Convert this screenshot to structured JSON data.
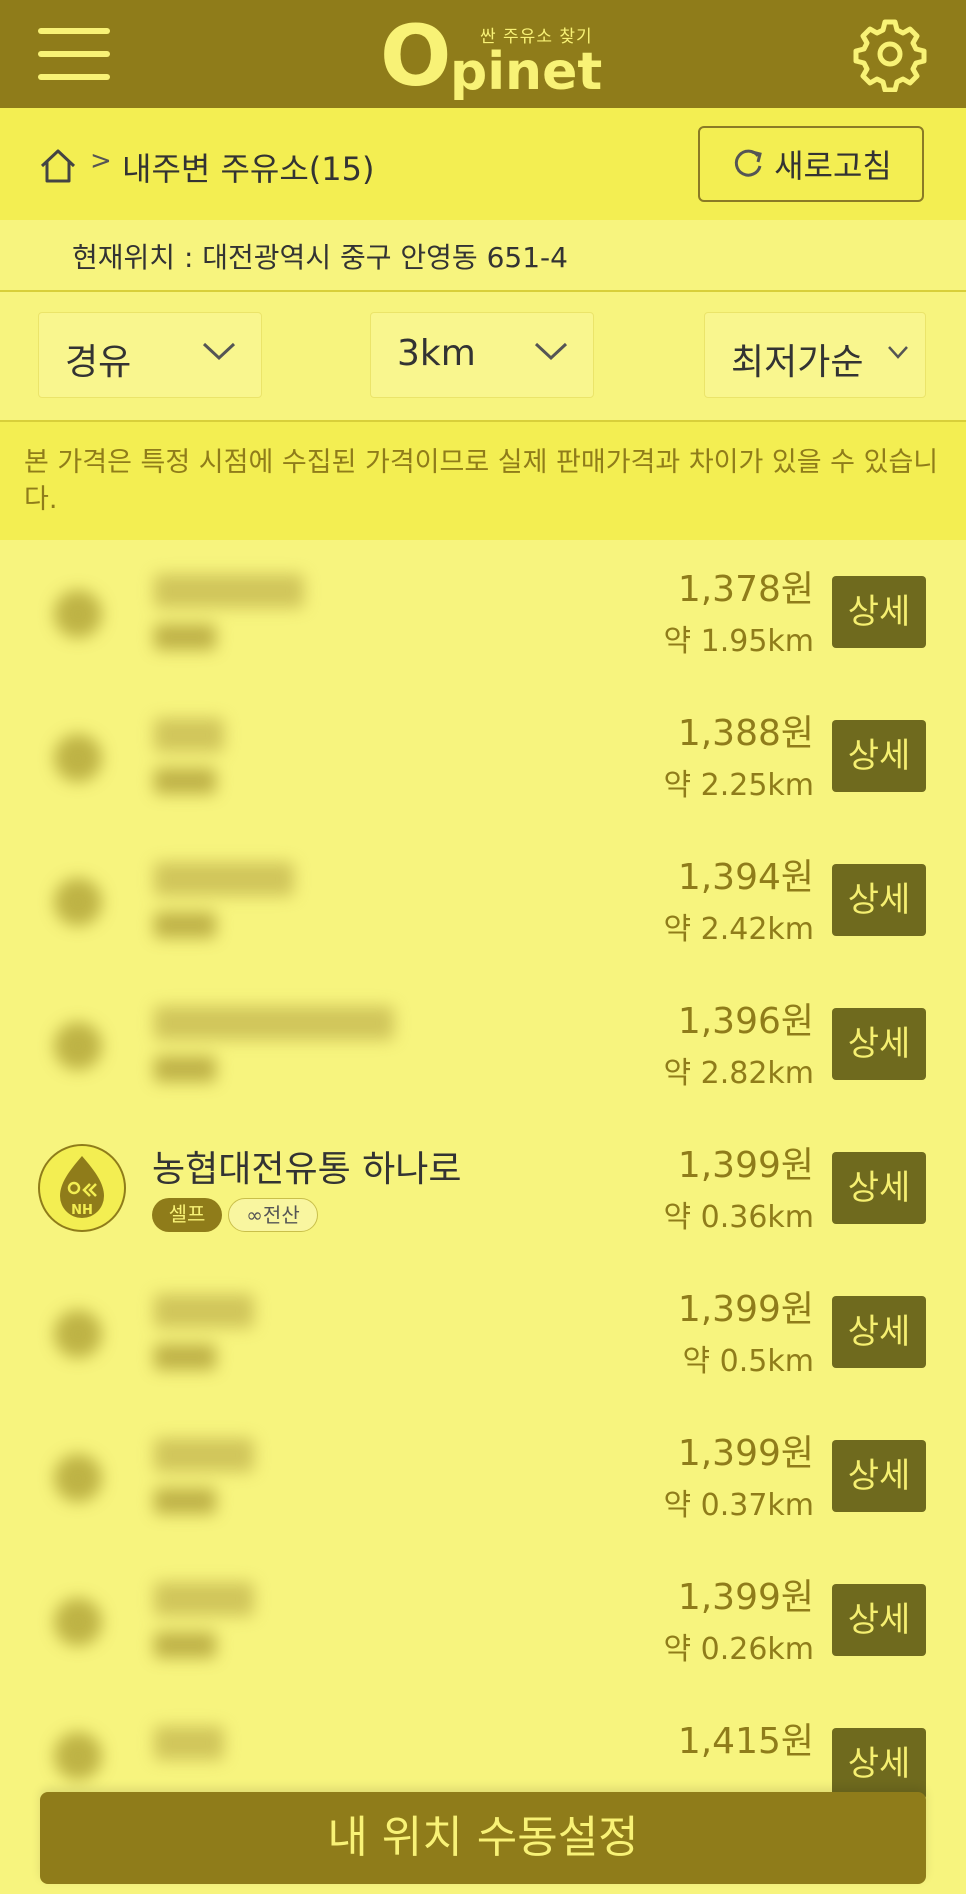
{
  "header": {
    "logo_sub": "싼 주유소 찾기",
    "logo_o": "O",
    "logo_rest": "pinet",
    "brand_color": "#8f7c1a"
  },
  "breadcrumb": {
    "title": "내주변 주유소(15)"
  },
  "refresh_label": "새로고침",
  "location_text": "현재위치 : 대전광역시 중구 안영동 651-4",
  "filters": {
    "fuel": "경유",
    "radius": "3km",
    "sort": "최저가순"
  },
  "notice": "본 가격은 특정 시점에 수집된 가격이므로 실제 판매가격과 차이가 있을 수 있습니다.",
  "stations": [
    {
      "price": "1,378원",
      "distance": "약 1.95km",
      "detail": "상세"
    },
    {
      "price": "1,388원",
      "distance": "약 2.25km",
      "detail": "상세"
    },
    {
      "price": "1,394원",
      "distance": "약 2.42km",
      "detail": "상세"
    },
    {
      "price": "1,396원",
      "distance": "약 2.82km",
      "detail": "상세"
    },
    {
      "name": "농협대전유통 하나로",
      "logo_text": "NH",
      "tags": [
        "셀프",
        "전산"
      ],
      "price": "1,399원",
      "distance": "약 0.36km",
      "detail": "상세"
    },
    {
      "price": "1,399원",
      "distance": "약 0.5km",
      "detail": "상세"
    },
    {
      "price": "1,399원",
      "distance": "약 0.37km",
      "detail": "상세"
    },
    {
      "price": "1,399원",
      "distance": "약 0.26km",
      "detail": "상세"
    },
    {
      "price": "1,415원",
      "detail": "상세"
    }
  ],
  "manual_location_label": "내 위치 수동설정"
}
